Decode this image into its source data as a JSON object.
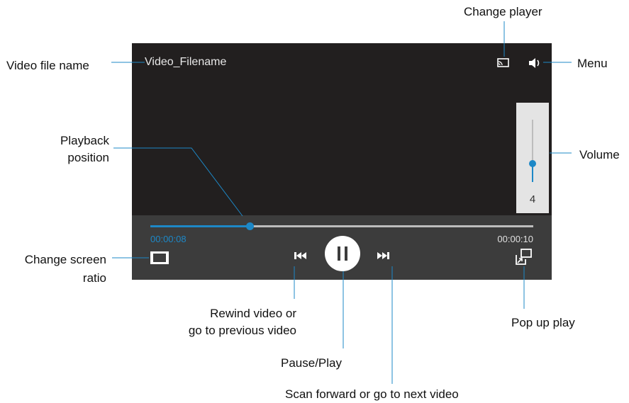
{
  "player": {
    "filename": "Video_Filename",
    "current_time": "00:00:08",
    "total_time": "00:00:10",
    "playback_fraction": 0.26,
    "volume_level": "4",
    "volume_fraction": 0.3
  },
  "callouts": {
    "change_player": "Change player",
    "video_file_name": "Video file name",
    "menu": "Menu",
    "playback_position_1": "Playback",
    "playback_position_2": "position",
    "volume": "Volume",
    "change_screen_ratio_1": "Change screen",
    "change_screen_ratio_2": "ratio",
    "rewind_1": "Rewind video or",
    "rewind_2": "go to previous video",
    "pop_up_play": "Pop up play",
    "pause_play": "Pause/Play",
    "scan_forward": "Scan forward or go to next video"
  },
  "colors": {
    "accent": "#1d88c7",
    "screen": "#221f1f",
    "control_bar": "#3c3c3c"
  },
  "icons": [
    "screen-mirroring-icon",
    "speaker-icon",
    "screen-ratio-icon",
    "rewind-icon",
    "pause-icon",
    "forward-icon",
    "popup-play-icon"
  ]
}
